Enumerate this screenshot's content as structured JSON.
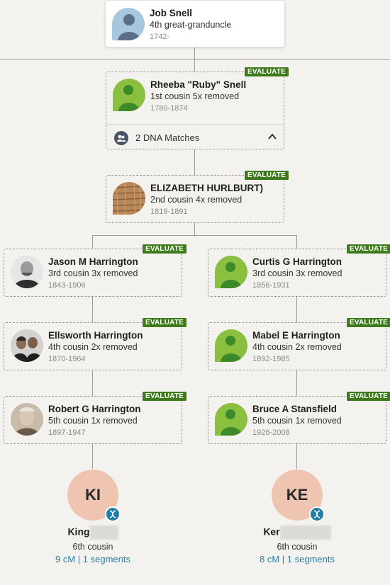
{
  "colors": {
    "evaluate_badge": "#3d7a1a",
    "link": "#2b7ea8",
    "avatar_bg": "#efc5b2",
    "leaf_green": "#8bbf3f"
  },
  "top": {
    "name": "Job Snell",
    "relation": "4th great-granduncle",
    "years": "1742-",
    "icon": "person-silhouette-icon"
  },
  "gen1": {
    "name": "Rheeba \"Ruby\" Snell",
    "relation": "1st cousin 5x removed",
    "years": "1780-1874",
    "badge": "EVALUATE",
    "dna_matches_label": "2 DNA Matches",
    "dna_icon": "people-icon",
    "toggle_icon": "chevron-up-icon"
  },
  "gen2": {
    "name": "ELIZABETH HURLBURT)",
    "relation": "2nd cousin 4x removed",
    "years": "1819-1891",
    "badge": "EVALUATE"
  },
  "left": [
    {
      "name": "Jason M Harrington",
      "relation": "3rd cousin 3x removed",
      "years": "1843-1906",
      "badge": "EVALUATE"
    },
    {
      "name": "Ellsworth Harrington",
      "relation": "4th cousin 2x removed",
      "years": "1870-1964",
      "badge": "EVALUATE"
    },
    {
      "name": "Robert G Harrington",
      "relation": "5th cousin 1x removed",
      "years": "1897-1947",
      "badge": "EVALUATE"
    }
  ],
  "right": [
    {
      "name": "Curtis G Harrington",
      "relation": "3rd cousin 3x removed",
      "years": "1856-1931",
      "badge": "EVALUATE"
    },
    {
      "name": "Mabel E Harrington",
      "relation": "4th cousin 2x removed",
      "years": "1892-1985",
      "badge": "EVALUATE"
    },
    {
      "name": "Bruce A Stansfield",
      "relation": "5th cousin 1x removed",
      "years": "1926-2008",
      "badge": "EVALUATE"
    }
  ],
  "matches": [
    {
      "initials": "KI",
      "name": "King",
      "relation": "6th cousin",
      "shared": "9 cM | 1 segments"
    },
    {
      "initials": "KE",
      "name": "Ker",
      "relation": "6th cousin",
      "shared": "8 cM | 1 segments"
    }
  ]
}
